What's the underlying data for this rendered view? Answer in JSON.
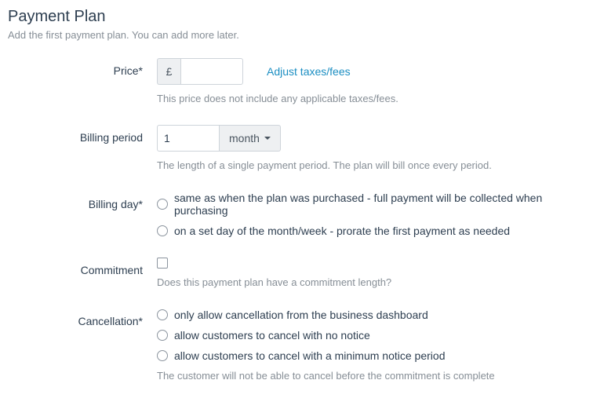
{
  "header": {
    "title": "Payment Plan",
    "subtitle": "Add the first payment plan. You can add more later."
  },
  "price": {
    "label": "Price*",
    "currency_symbol": "£",
    "value": "",
    "adjust_link": "Adjust taxes/fees",
    "hint": "This price does not include any applicable taxes/fees."
  },
  "billing_period": {
    "label": "Billing period",
    "value": "1",
    "unit": "month",
    "hint": "The length of a single payment period. The plan will bill once every period."
  },
  "billing_day": {
    "label": "Billing day*",
    "options": [
      "same as when the plan was purchased - full payment will be collected when purchasing",
      "on a set day of the month/week - prorate the first payment as needed"
    ]
  },
  "commitment": {
    "label": "Commitment",
    "checked": false,
    "hint": "Does this payment plan have a commitment length?"
  },
  "cancellation": {
    "label": "Cancellation*",
    "options": [
      "only allow cancellation from the business dashboard",
      "allow customers to cancel with no notice",
      "allow customers to cancel with a minimum notice period"
    ],
    "hint": "The customer will not be able to cancel before the commitment is complete"
  }
}
